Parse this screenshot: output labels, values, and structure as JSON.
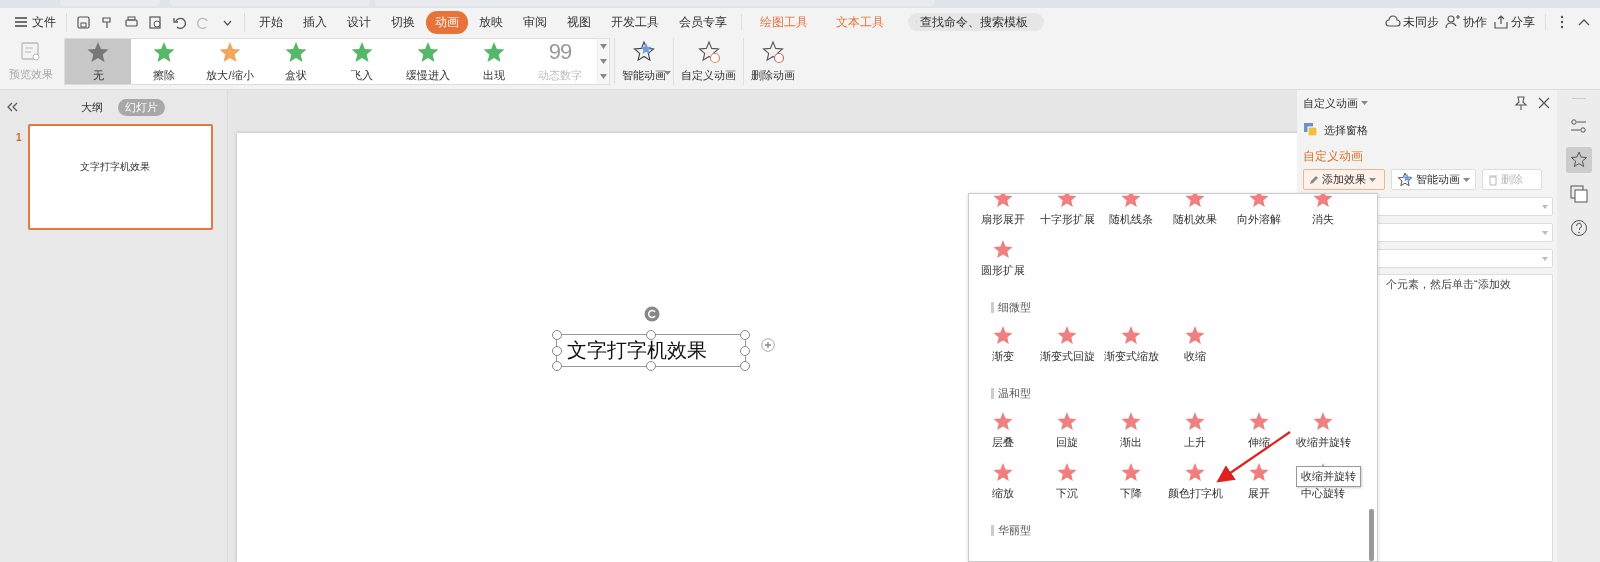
{
  "menu": {
    "file": "文件",
    "tabs": [
      {
        "label": "开始",
        "selected": false
      },
      {
        "label": "插入",
        "selected": false
      },
      {
        "label": "设计",
        "selected": false
      },
      {
        "label": "切换",
        "selected": false
      },
      {
        "label": "动画",
        "selected": true
      },
      {
        "label": "放映",
        "selected": false
      },
      {
        "label": "审阅",
        "selected": false
      },
      {
        "label": "视图",
        "selected": false
      },
      {
        "label": "开发工具",
        "selected": false
      },
      {
        "label": "会员专享",
        "selected": false
      }
    ],
    "context_tabs": [
      "绘图工具",
      "文本工具"
    ],
    "search": {
      "placeholder": "查找命令、搜索模板"
    },
    "right": [
      {
        "kind": "cloud",
        "label": "未同步"
      },
      {
        "kind": "people",
        "label": "协作"
      },
      {
        "kind": "share",
        "label": "分享"
      }
    ]
  },
  "ribbon": {
    "preview": {
      "label": "预览效果",
      "disabled": true
    },
    "gallery": [
      {
        "label": "无",
        "kind": "none",
        "selected": true,
        "disabled": false
      },
      {
        "label": "擦除",
        "kind": "green",
        "selected": false,
        "disabled": false
      },
      {
        "label": "放大/缩小",
        "kind": "orange",
        "selected": false,
        "disabled": false
      },
      {
        "label": "盒状",
        "kind": "green",
        "selected": false,
        "disabled": false
      },
      {
        "label": "飞入",
        "kind": "green",
        "selected": false,
        "disabled": false
      },
      {
        "label": "缓慢进入",
        "kind": "green",
        "selected": false,
        "disabled": false
      },
      {
        "label": "出现",
        "kind": "green",
        "selected": false,
        "disabled": false
      },
      {
        "label": "动态数字",
        "kind": "counter",
        "icon_text": "99",
        "selected": false,
        "disabled": true
      }
    ],
    "actions": [
      {
        "kind": "smart",
        "label": "智能动画",
        "dropdown": true
      },
      {
        "kind": "custom",
        "label": "自定义动画",
        "dropdown": false
      },
      {
        "kind": "delete",
        "label": "删除动画",
        "dropdown": false
      }
    ]
  },
  "slides_panel": {
    "tabs": [
      {
        "label": "大纲",
        "selected": false
      },
      {
        "label": "幻灯片",
        "selected": true
      }
    ],
    "slides": [
      {
        "number": "1",
        "selected": true,
        "text": "文字打字机效果"
      }
    ]
  },
  "slide": {
    "text": "文字打字机效果"
  },
  "effects_menu": {
    "groups": [
      {
        "items": [
          "扇形展开",
          "十字形扩展",
          "随机线条",
          "随机效果",
          "向外溶解",
          "消失",
          "圆形扩展"
        ]
      },
      {
        "title": "细微型",
        "items": [
          "渐变",
          "渐变式回旋",
          "渐变式缩放",
          "收缩"
        ]
      },
      {
        "title": "温和型",
        "items": [
          "层叠",
          "回旋",
          "渐出",
          "上升",
          "伸缩",
          "收缩并旋转",
          "缩放",
          "下沉",
          "下降",
          "颜色打字机",
          "展开",
          "中心旋转"
        ]
      },
      {
        "title": "华丽型"
      }
    ],
    "tooltip": "收缩并旋转"
  },
  "task_pane": {
    "title": "自定义动画",
    "select_pane": "选择窗格",
    "section": "自定义动画",
    "add_effect": "添加效果",
    "smart": "智能动画",
    "delete": {
      "label": "删除",
      "disabled": true
    },
    "hint": "个元素，然后单击“添加效"
  }
}
